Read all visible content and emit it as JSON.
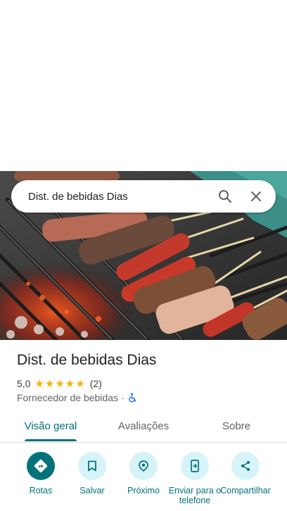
{
  "search": {
    "query": "Dist. de bebidas Dias",
    "search_icon": "search-icon",
    "close_icon": "close-icon"
  },
  "place": {
    "name": "Dist. de bebidas Dias",
    "rating": "5,0",
    "stars": "★★★★★",
    "review_count": "(2)",
    "category": "Fornecedor de bebidas",
    "separator": "·",
    "accessibility_icon": "wheelchair-icon"
  },
  "tabs": [
    {
      "label": "Visão geral",
      "active": true
    },
    {
      "label": "Avaliações",
      "active": false
    },
    {
      "label": "Sobre",
      "active": false
    }
  ],
  "actions": [
    {
      "label": "Rotas",
      "icon": "directions-icon"
    },
    {
      "label": "Salvar",
      "icon": "bookmark-icon"
    },
    {
      "label": "Próximo",
      "icon": "nearby-icon"
    },
    {
      "label": "Enviar para o telefone",
      "icon": "send-to-phone-icon"
    },
    {
      "label": "Compartilhar",
      "icon": "share-icon"
    }
  ],
  "colors": {
    "accent": "#00737a",
    "action_bg": "#d6f3f8",
    "star": "#f4b400"
  }
}
